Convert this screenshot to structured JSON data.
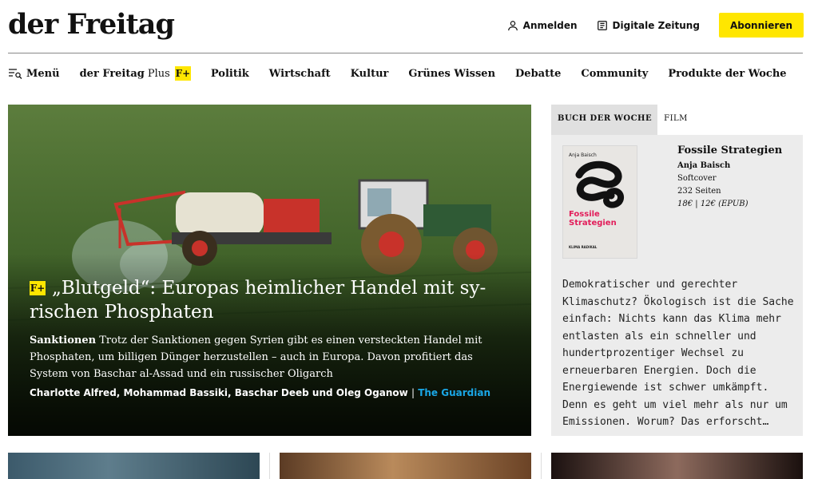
{
  "header": {
    "logo": "der Freitag",
    "login_label": "Anmelden",
    "digital_label": "Digitale Zeitung",
    "subscribe_label": "Abonnieren"
  },
  "nav": {
    "menu_label": "Menü",
    "plus_brand": "der Freitag",
    "plus_word": "Plus",
    "plus_badge": "F+",
    "items": [
      "Politik",
      "Wirtschaft",
      "Kultur",
      "Grünes Wissen",
      "Debatte",
      "Community",
      "Produkte der Woche"
    ]
  },
  "hero": {
    "badge": "F+",
    "title": "„Blutgeld“: Europas heimlicher Handel mit sy-rischen Phosphaten",
    "kicker": "Sanktionen",
    "teaser": "Trotz der Sanktionen gegen Syrien gibt es einen versteckten Handel mit Phosphaten, um billigen Dünger herzustellen – auch in Europa. Davon profitiert das System von Baschar al-Assad und ein russischer Oligarch",
    "authors": "Charlotte Alfred, Mohammad Bassiki, Baschar Deeb und Oleg Oganow",
    "separator": "|",
    "source": "The Guardian"
  },
  "sidebar": {
    "tabs": [
      "BUCH DER WOCHE",
      "FILM"
    ],
    "cover_author": "Anja Baisch",
    "cover_title": "Fossile Strategien",
    "cover_publisher": "KLIMA RADIKAL",
    "book_title": "Fossile Strategien",
    "book_author": "Anja Baisch",
    "book_format": "Softcover",
    "book_pages": "232 Seiten",
    "book_price": "18€ | 12€ (EPUB)",
    "description": "Demokratischer und gerechter Klimaschutz? Ökologisch ist die Sache einfach: Nichts kann das Klima mehr entlasten als ein schneller und hundertprozentiger Wechsel zu erneuerbaren Energien. Doch die Energiewende ist schwer umkämpft. Denn es geht um viel mehr als nur um Emissionen. Worum? Das erforscht…"
  },
  "colors": {
    "accent_yellow": "#ffe600",
    "source_blue": "#1aa7e6",
    "cover_red": "#e21d5a"
  }
}
